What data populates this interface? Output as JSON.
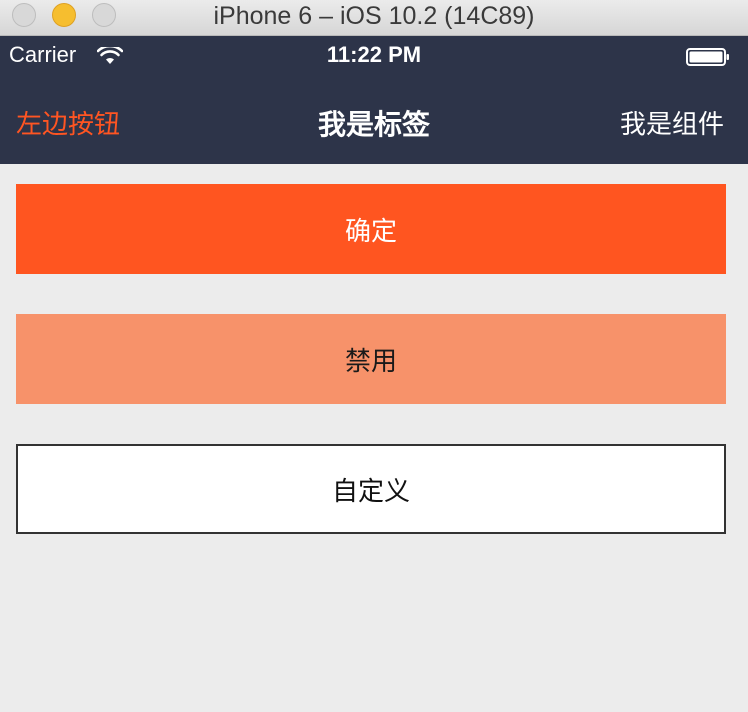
{
  "window": {
    "title": "iPhone 6 – iOS 10.2 (14C89)"
  },
  "status_bar": {
    "carrier": "Carrier",
    "time": "11:22 PM"
  },
  "nav_bar": {
    "left_button": "左边按钮",
    "title": "我是标签",
    "right_button": "我是组件"
  },
  "buttons": {
    "confirm": "确定",
    "disabled": "禁用",
    "custom": "自定义"
  },
  "colors": {
    "nav_background": "#2d3449",
    "accent": "#ff5520",
    "disabled": "#f7926a"
  }
}
